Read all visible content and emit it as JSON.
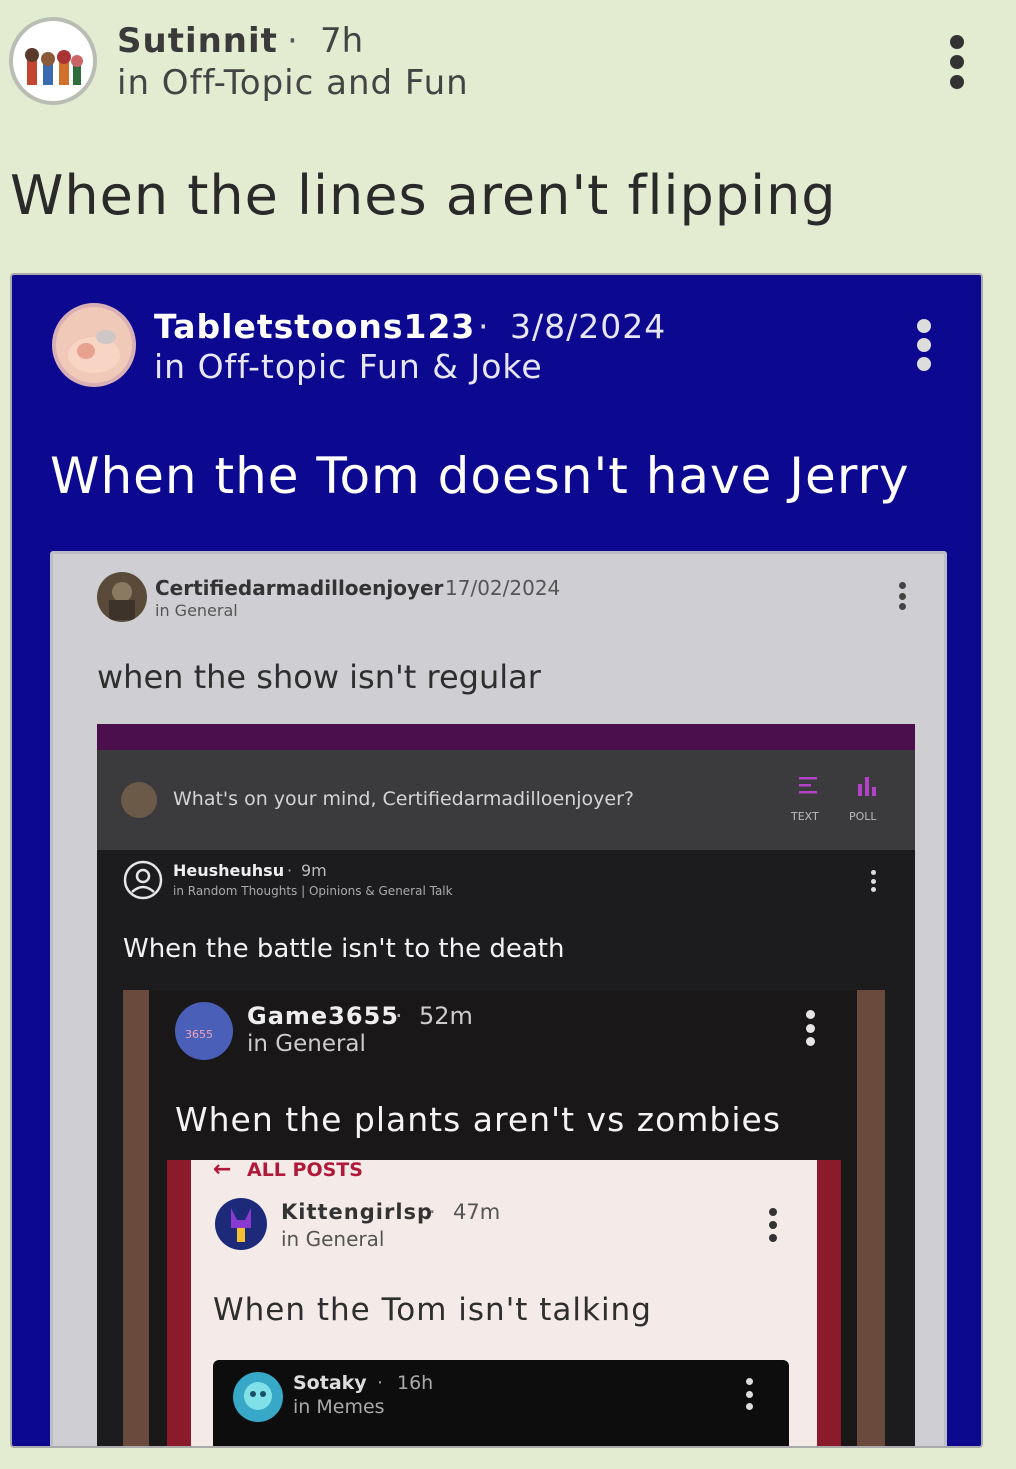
{
  "post": {
    "author": "Sutinnit",
    "time": "7h",
    "community": "in Off-Topic and Fun",
    "title": "When the lines aren't flipping",
    "menu_icon": "more-vertical-icon"
  },
  "embed1": {
    "author": "Tabletstoons123",
    "time": "3/8/2024",
    "community": "in Off-topic Fun & Joke",
    "title": "When the Tom doesn't have Jerry"
  },
  "embed2": {
    "author": "Certifiedarmadilloenjoyer",
    "time": "17/02/2024",
    "community": "in General",
    "title": "when the show isn't regular"
  },
  "embed3": {
    "composer_placeholder": "What's on your mind, Certifiedarmadilloenjoyer?",
    "text_label": "TEXT",
    "poll_label": "POLL",
    "author": "Heusheuhsu",
    "time": "9m",
    "community": "in Random Thoughts | Opinions & General Talk",
    "title": "When the battle isn't to the death"
  },
  "embed4": {
    "author": "Game3655",
    "time": "52m",
    "community": "in General",
    "title": "When the plants aren't vs zombies",
    "avatar_text": "3655"
  },
  "embed5": {
    "back_label": "ALL POSTS",
    "author": "Kittengirlsp",
    "time": "47m",
    "community": "in General",
    "title": "When the Tom isn't talking"
  },
  "embed6": {
    "author": "Sotaky",
    "time": "16h",
    "community": "in Memes"
  },
  "colors": {
    "page_bg": "#e3ecd1",
    "embed1_bg": "#0c0890",
    "embed3_bg": "#1c1c1e",
    "accent_red": "#8b1a2b"
  }
}
